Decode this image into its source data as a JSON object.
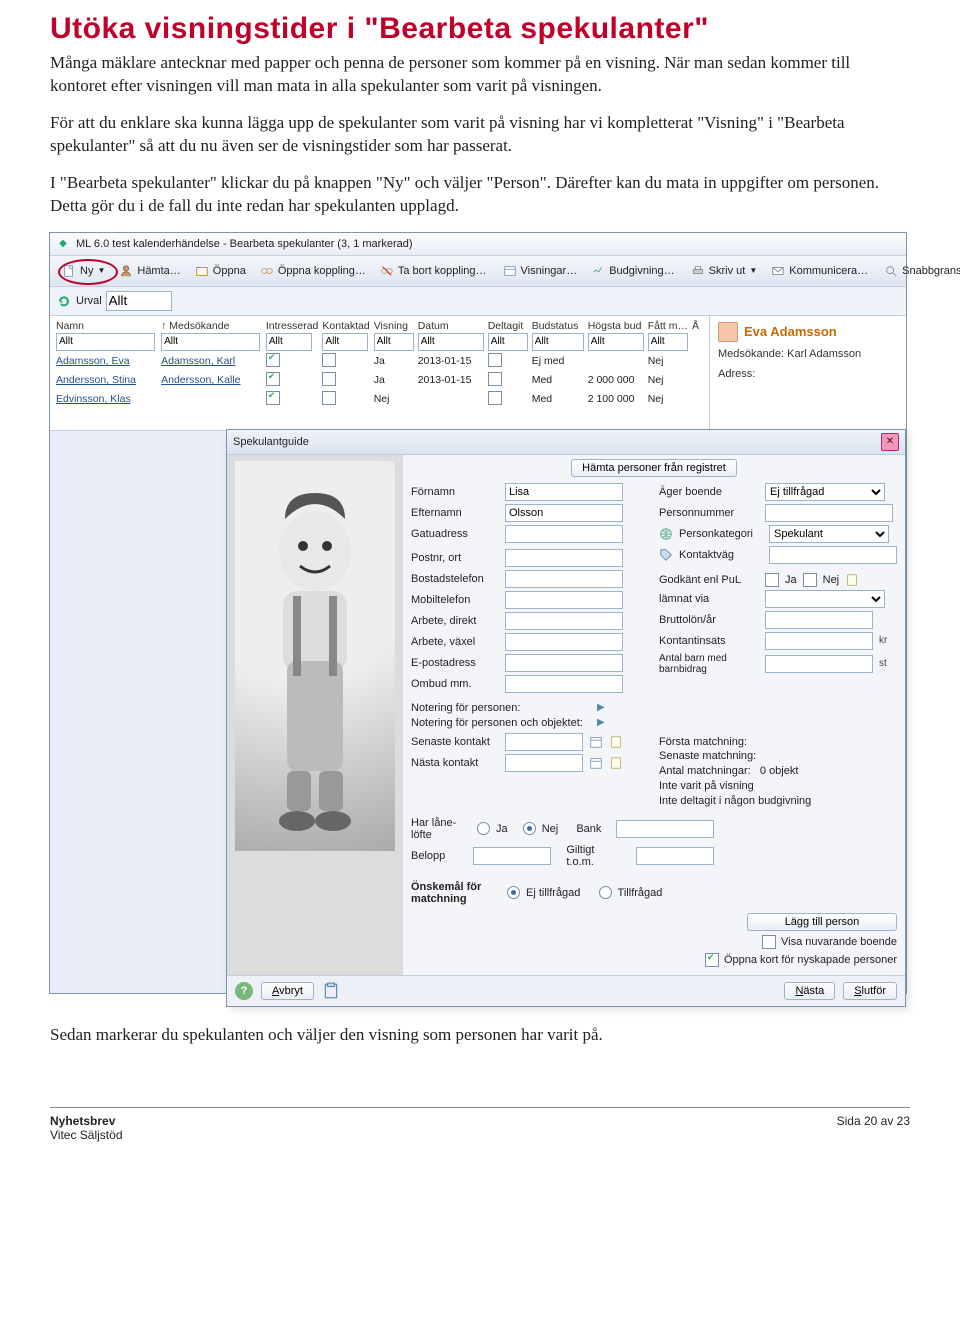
{
  "title": "Utöka visningstider i \"Bearbeta spekulanter\"",
  "para1": "Många mäklare antecknar med papper och penna de personer som kommer på en visning. När man sedan kommer till kontoret efter visningen vill man mata in alla spekulanter som varit på visningen.",
  "para2": "För att du enklare ska kunna lägga upp de spekulanter som varit på visning har vi kompletterat \"Visning\" i \"Bearbeta spekulanter\" så att du nu även ser de visningstider som har passerat.",
  "para3": "I \"Bearbeta spekulanter\" klickar du på knappen \"Ny\" och väljer \"Person\". Därefter kan du mata in uppgifter om personen. Detta gör du i de fall du inte redan har spekulanten upplagd.",
  "after": "Sedan markerar du spekulanten och väljer den visning som personen har varit på.",
  "footer": {
    "left1": "Nyhetsbrev",
    "left2": "Vitec Säljstöd",
    "right": "Sida 20 av 23"
  },
  "app": {
    "title": "ML 6.0 test kalenderhändelse - Bearbeta spekulanter (3, 1 markerad)",
    "toolbar": {
      "ny": "Ny",
      "hamta": "Hämta…",
      "oppna": "Öppna",
      "oppnakopp": "Öppna koppling…",
      "tabort": "Ta bort koppling…",
      "visningar": "Visningar…",
      "budgivning": "Budgivning…",
      "skrivut": "Skriv ut",
      "kommunicera": "Kommunicera…",
      "snabb": "Snabbgrans"
    },
    "urval": {
      "label": "Urval",
      "value": "Allt"
    },
    "columns": [
      "Namn",
      "Medsökande",
      "Intresserad",
      "Kontaktad",
      "Visning",
      "Datum",
      "Deltagit",
      "Budstatus",
      "Högsta bud",
      "Fått m…"
    ],
    "filter": "Allt",
    "rows": [
      {
        "namn": "Adamsson, Eva",
        "med": "Adamsson, Karl",
        "intr": true,
        "kont": false,
        "vis": "Ja",
        "datum": "2013-01-15",
        "delt": false,
        "bud": "Ej med",
        "hog": "",
        "fat": "Nej"
      },
      {
        "namn": "Andersson, Stina",
        "med": "Andersson, Kalle",
        "intr": true,
        "kont": false,
        "vis": "Ja",
        "datum": "2013-01-15",
        "delt": false,
        "bud": "Med",
        "hog": "2 000 000",
        "fat": "Nej"
      },
      {
        "namn": "Edvinsson, Klas",
        "med": "",
        "intr": true,
        "kont": false,
        "vis": "Nej",
        "datum": "",
        "delt": false,
        "bud": "Med",
        "hog": "2 100 000",
        "fat": "Nej"
      }
    ],
    "side": {
      "broker": "Eva Adamsson",
      "medsok_label": "Medsökande:",
      "medsok_val": "Karl Adamsson",
      "adress_label": "Adress:"
    }
  },
  "dlg": {
    "title": "Spekulantguide",
    "regbtn": "Hämta personer från registret",
    "labels": {
      "fornamn": "Förnamn",
      "efternamn": "Efternamn",
      "gatu": "Gatuadress",
      "postnr": "Postnr, ort",
      "bostad": "Bostadstelefon",
      "mobil": "Mobiltelefon",
      "arbdir": "Arbete, direkt",
      "arbvax": "Arbete, växel",
      "epost": "E-postadress",
      "ombud": "Ombud mm.",
      "notpers": "Notering för personen:",
      "notobj": "Notering för personen och objektet:",
      "senkont": "Senaste kontakt",
      "nastkont": "Nästa kontakt",
      "lanelofte": "Har låne- löfte",
      "belopp": "Belopp",
      "bank": "Bank",
      "giltig": "Giltigt t.o.m.",
      "onsk": "Önskemål för matchning",
      "ager": "Äger boende",
      "personnr": "Personnummer",
      "pkat": "Personkategori",
      "kontaktvag": "Kontaktväg",
      "godkant": "Godkänt enl PuL",
      "lamnat": "lämnat via",
      "brutto": "Bruttolön/år",
      "kontant": "Kontantinsats",
      "antalbarn": "Antal barn med barnbidrag"
    },
    "vals": {
      "fornamn": "Lisa",
      "efternamn": "Olsson",
      "ager": "Ej tillfrågad",
      "pkat": "Spekulant",
      "ja": "Ja",
      "nej": "Nej"
    },
    "match": {
      "l1": "Första matchning:",
      "l2": "Senaste matchning:",
      "l3": "Antal matchningar:",
      "l3v": "0 objekt",
      "l4": "Inte varit på visning",
      "l5": "Inte deltagit i någon budgivning"
    },
    "onsk_opts": {
      "ej": "Ej tillfrågad",
      "till": "Tillfrågad"
    },
    "right": {
      "lagg": "Lägg till person",
      "visa": "Visa nuvarande boende",
      "oppna": "Öppna kort för nyskapade personer"
    },
    "units": {
      "kr": "kr",
      "st": "st"
    },
    "footer": {
      "avbryt": "Avbryt",
      "nasta": "Nästa",
      "slutfor": "Slutför"
    }
  }
}
